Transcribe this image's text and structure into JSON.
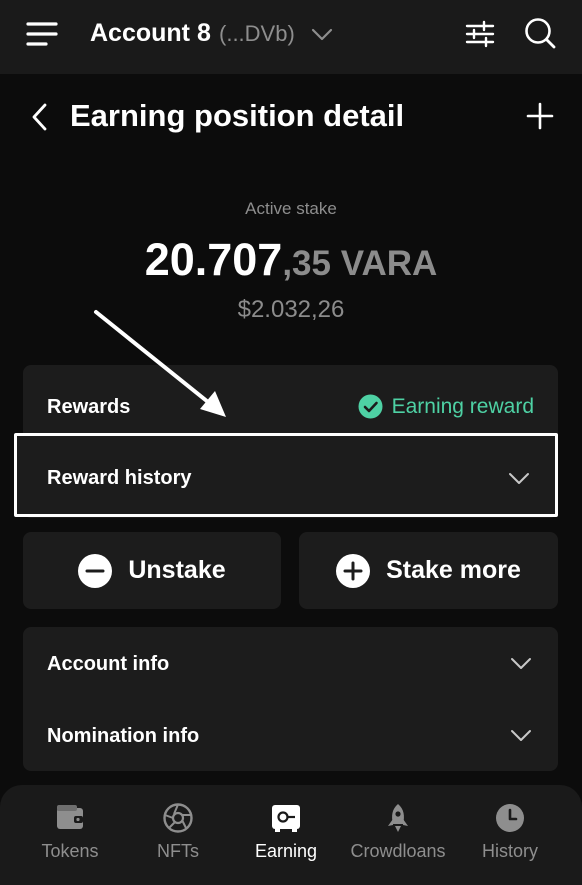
{
  "header": {
    "account_name": "Account 8",
    "account_address": "(...DVb)",
    "icons": [
      "menu-icon",
      "chevron-down-icon",
      "filter-icon",
      "search-icon"
    ]
  },
  "page": {
    "title": "Earning position detail",
    "icons": [
      "back-icon",
      "plus-icon"
    ]
  },
  "stake": {
    "label": "Active stake",
    "amount_int": "20.707",
    "amount_dec": ",35 VARA",
    "usd": "$2.032,26"
  },
  "rewards": {
    "label": "Rewards",
    "status": "Earning reward",
    "history_label": "Reward history"
  },
  "actions": {
    "unstake": "Unstake",
    "stake_more": "Stake more"
  },
  "info": {
    "account_info": "Account info",
    "nomination_info": "Nomination info"
  },
  "nav": {
    "items": [
      {
        "label": "Tokens",
        "icon": "wallet-icon",
        "active": false
      },
      {
        "label": "NFTs",
        "icon": "aperture-icon",
        "active": false
      },
      {
        "label": "Earning",
        "icon": "safe-icon",
        "active": true
      },
      {
        "label": "Crowdloans",
        "icon": "rocket-icon",
        "active": false
      },
      {
        "label": "History",
        "icon": "clock-icon",
        "active": false
      }
    ]
  },
  "colors": {
    "background": "#0c0c0c",
    "surface": "#1c1c1c",
    "accent_green": "#4ed1a4",
    "muted_text": "#8e8e8e"
  }
}
